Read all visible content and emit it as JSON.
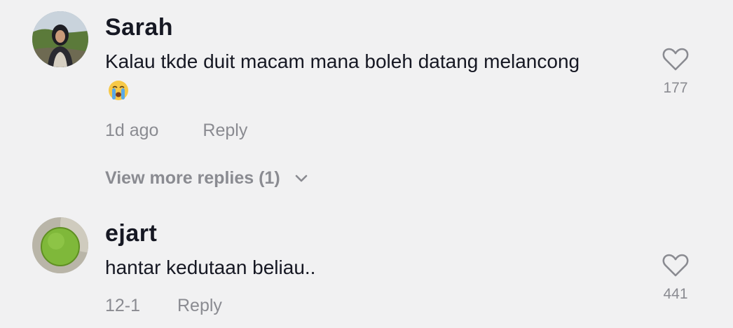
{
  "comments": [
    {
      "username": "Sarah",
      "text": "Kalau tkde duit macam mana boleh datang melancong",
      "emoji": "loudly-crying-face-emoji",
      "time": "1d ago",
      "reply_label": "Reply",
      "likes": "177",
      "more_replies": "View more replies (1)"
    },
    {
      "username": "ejart",
      "text": "hantar kedutaan beliau..",
      "time": "12-1",
      "reply_label": "Reply",
      "likes": "441"
    }
  ],
  "icons": {
    "like": "heart-outline-icon",
    "expand": "chevron-down-icon"
  },
  "colors": {
    "background": "#f1f1f2",
    "primary_text": "#161823",
    "secondary_text": "#8a8b91"
  }
}
